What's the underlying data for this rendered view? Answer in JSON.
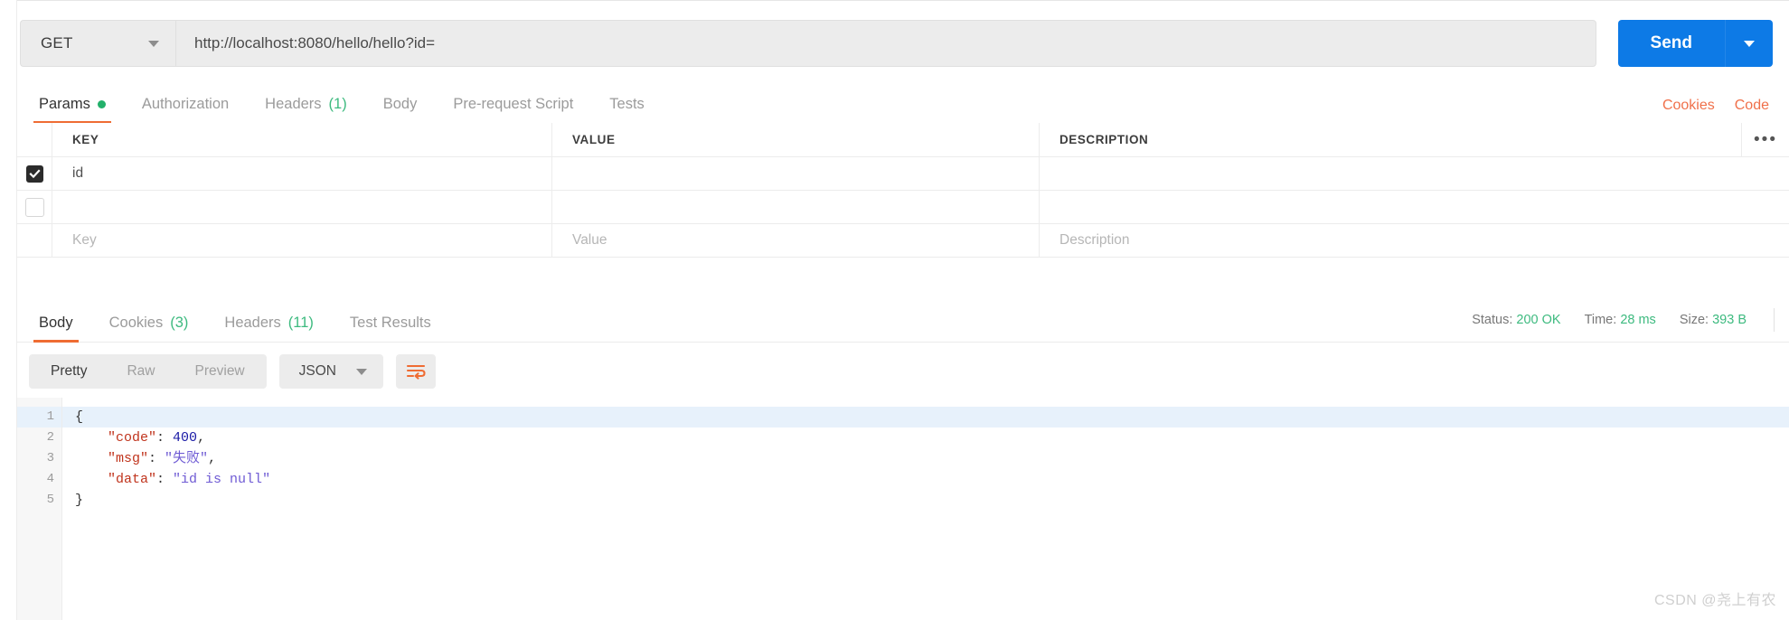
{
  "request": {
    "method": "GET",
    "url": "http://localhost:8080/hello/hello?id=",
    "send_label": "Send"
  },
  "request_tabs": [
    {
      "label": "Params",
      "badge": "",
      "dot": true,
      "active": true
    },
    {
      "label": "Authorization",
      "badge": "",
      "dot": false,
      "active": false
    },
    {
      "label": "Headers",
      "badge": "(1)",
      "dot": false,
      "active": false
    },
    {
      "label": "Body",
      "badge": "",
      "dot": false,
      "active": false
    },
    {
      "label": "Pre-request Script",
      "badge": "",
      "dot": false,
      "active": false
    },
    {
      "label": "Tests",
      "badge": "",
      "dot": false,
      "active": false
    }
  ],
  "tabbar_right": {
    "cookies": "Cookies",
    "code": "Code"
  },
  "params_table": {
    "columns": [
      "KEY",
      "VALUE",
      "DESCRIPTION"
    ],
    "menu_icon": "•••",
    "rows": [
      {
        "checked": true,
        "key": "id",
        "value": "",
        "description": ""
      },
      {
        "checked": false,
        "key": "",
        "value": "",
        "description": ""
      }
    ],
    "placeholders": {
      "key": "Key",
      "value": "Value",
      "description": "Description"
    }
  },
  "response_tabs": [
    {
      "label": "Body",
      "badge": "",
      "active": true
    },
    {
      "label": "Cookies",
      "badge": "(3)",
      "active": false
    },
    {
      "label": "Headers",
      "badge": "(11)",
      "active": false
    },
    {
      "label": "Test Results",
      "badge": "",
      "active": false
    }
  ],
  "response_meta": {
    "status_label": "Status:",
    "status_value": "200 OK",
    "time_label": "Time:",
    "time_value": "28 ms",
    "size_label": "Size:",
    "size_value": "393 B"
  },
  "view_toolbar": {
    "modes": [
      "Pretty",
      "Raw",
      "Preview"
    ],
    "active_mode": "Pretty",
    "format": "JSON",
    "wrap_icon": "wrap-lines-icon"
  },
  "body_code": {
    "lines": [
      {
        "n": "1",
        "fold": true,
        "tokens": [
          {
            "t": "{",
            "c": "punct"
          }
        ]
      },
      {
        "n": "2",
        "fold": false,
        "tokens": [
          {
            "t": "    ",
            "c": "punct"
          },
          {
            "t": "\"code\"",
            "c": "k"
          },
          {
            "t": ": ",
            "c": "punct"
          },
          {
            "t": "400",
            "c": "num"
          },
          {
            "t": ",",
            "c": "punct"
          }
        ]
      },
      {
        "n": "3",
        "fold": false,
        "tokens": [
          {
            "t": "    ",
            "c": "punct"
          },
          {
            "t": "\"msg\"",
            "c": "k"
          },
          {
            "t": ": ",
            "c": "punct"
          },
          {
            "t": "\"失败\"",
            "c": "str"
          },
          {
            "t": ",",
            "c": "punct"
          }
        ]
      },
      {
        "n": "4",
        "fold": false,
        "tokens": [
          {
            "t": "    ",
            "c": "punct"
          },
          {
            "t": "\"data\"",
            "c": "k"
          },
          {
            "t": ": ",
            "c": "punct"
          },
          {
            "t": "\"id is null\"",
            "c": "str"
          }
        ]
      },
      {
        "n": "5",
        "fold": false,
        "tokens": [
          {
            "t": "}",
            "c": "punct"
          }
        ]
      }
    ]
  },
  "watermark": "CSDN @尧上有农",
  "colors": {
    "accent_orange": "#ef6c33",
    "send_blue": "#0d7ae6",
    "status_green": "#3dba7f",
    "link_orange": "#f0704a"
  }
}
